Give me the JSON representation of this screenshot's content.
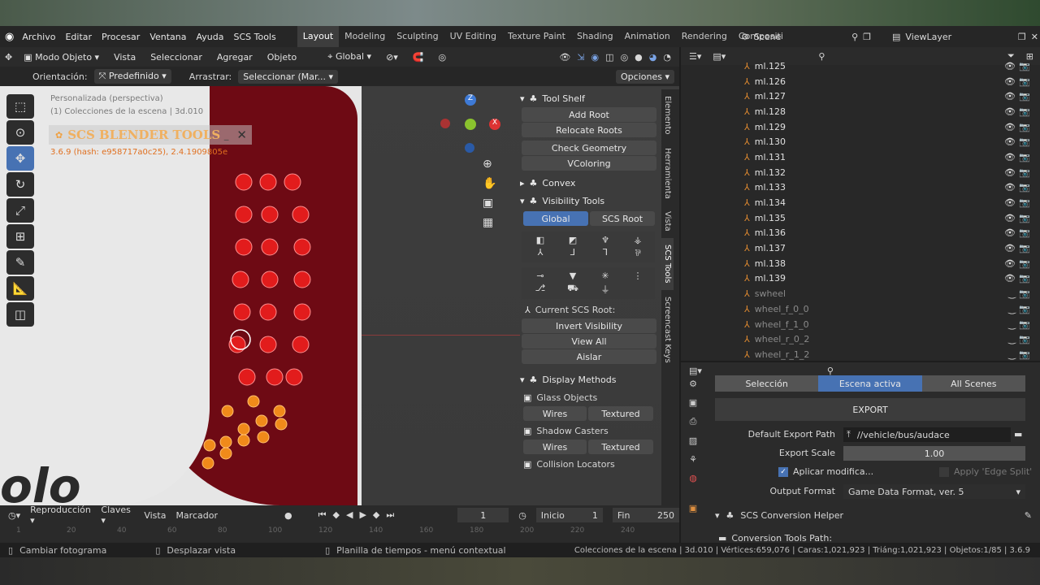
{
  "menu": {
    "items": [
      "Archivo",
      "Editar",
      "Procesar",
      "Ventana",
      "Ayuda",
      "SCS Tools"
    ],
    "workspaces": [
      "Layout",
      "Modeling",
      "Sculpting",
      "UV Editing",
      "Texture Paint",
      "Shading",
      "Animation",
      "Rendering",
      "Compositi"
    ],
    "scene": "Scene",
    "view_layer": "ViewLayer"
  },
  "viewport_header": {
    "mode": "Modo Objeto",
    "menus": [
      "Vista",
      "Seleccionar",
      "Agregar",
      "Objeto"
    ],
    "transform": "Global",
    "orientation_label": "Orientación:",
    "orientation_value": "Predefinido",
    "drag_label": "Arrastrar:",
    "drag_value": "Seleccionar (Mar...",
    "options": "Opciones"
  },
  "viewport": {
    "overlay_line1": "Personalizada (perspectiva)",
    "overlay_line2": "(1) Colecciones de la escena | 3d.010",
    "addon_title": "SCS BLENDER TOOLS",
    "addon_version": "3.6.9 (hash: e958717a0c25), 2.4.1909805e",
    "bg_text": "olo"
  },
  "npanel": {
    "tool_shelf": "Tool Shelf",
    "add_root": "Add Root",
    "relocate_roots": "Relocate Roots",
    "check_geometry": "Check Geometry",
    "vcoloring": "VColoring",
    "convex": "Convex",
    "visibility_tools": "Visibility Tools",
    "global": "Global",
    "scs_root": "SCS Root",
    "current_root": "Current SCS Root:",
    "invert_visibility": "Invert Visibility",
    "view_all": "View All",
    "aislar": "Aislar",
    "display_methods": "Display Methods",
    "glass_objects": "Glass Objects",
    "wires1": "Wires",
    "textured1": "Textured",
    "shadow_casters": "Shadow Casters",
    "wires2": "Wires",
    "textured2": "Textured",
    "collision_locators": "Collision Locators",
    "tabs": [
      "Elemento",
      "Herramienta",
      "Vista",
      "SCS Tools",
      "Screencast Keys"
    ]
  },
  "outliner": {
    "rows": [
      {
        "name": "ml.125",
        "dim": false
      },
      {
        "name": "ml.126",
        "dim": false
      },
      {
        "name": "ml.127",
        "dim": false
      },
      {
        "name": "ml.128",
        "dim": false
      },
      {
        "name": "ml.129",
        "dim": false
      },
      {
        "name": "ml.130",
        "dim": false
      },
      {
        "name": "ml.131",
        "dim": false
      },
      {
        "name": "ml.132",
        "dim": false
      },
      {
        "name": "ml.133",
        "dim": false
      },
      {
        "name": "ml.134",
        "dim": false
      },
      {
        "name": "ml.135",
        "dim": false
      },
      {
        "name": "ml.136",
        "dim": false
      },
      {
        "name": "ml.137",
        "dim": false
      },
      {
        "name": "ml.138",
        "dim": false
      },
      {
        "name": "ml.139",
        "dim": false
      },
      {
        "name": "swheel",
        "dim": true
      },
      {
        "name": "wheel_f_0_0",
        "dim": true
      },
      {
        "name": "wheel_f_1_0",
        "dim": true
      },
      {
        "name": "wheel_r_0_2",
        "dim": true
      },
      {
        "name": "wheel_r_1_2",
        "dim": true
      }
    ]
  },
  "properties": {
    "tabs": [
      "Selección",
      "Escena activa",
      "All Scenes"
    ],
    "export": "EXPORT",
    "default_export_path_label": "Default Export Path",
    "default_export_path": "//vehicle/bus/audace",
    "export_scale_label": "Export Scale",
    "export_scale": "1.00",
    "apply_modifiers": "Aplicar modifica...",
    "apply_edge_split": "Apply 'Edge Split'",
    "output_format_label": "Output Format",
    "output_format": "Game Data Format, ver. 5",
    "conversion_helper": "SCS Conversion Helper",
    "conversion_tools_path": "Conversion Tools Path:"
  },
  "timeline": {
    "menus": [
      "Reproducción",
      "Claves",
      "Vista",
      "Marcador"
    ],
    "current_frame": "1",
    "start_label": "Inicio",
    "start": "1",
    "end_label": "Fin",
    "end": "250",
    "ruler": [
      "1",
      "20",
      "40",
      "60",
      "80",
      "100",
      "120",
      "140",
      "160",
      "180",
      "200",
      "220",
      "240"
    ]
  },
  "status": {
    "left": "Cambiar fotograma",
    "middle": "Desplazar vista",
    "context": "Planilla de tiempos - menú contextual",
    "stats": "Colecciones de la escena | 3d.010 | Vértices:659,076 | Caras:1,021,923 | Triáng:1,021,923 | Objetos:1/85 | 3.6.9"
  },
  "colors": {
    "accent": "#4772b3",
    "body_red": "#6e0a14",
    "light_red": "#e21c1c",
    "light_orange": "#f08a1a"
  }
}
